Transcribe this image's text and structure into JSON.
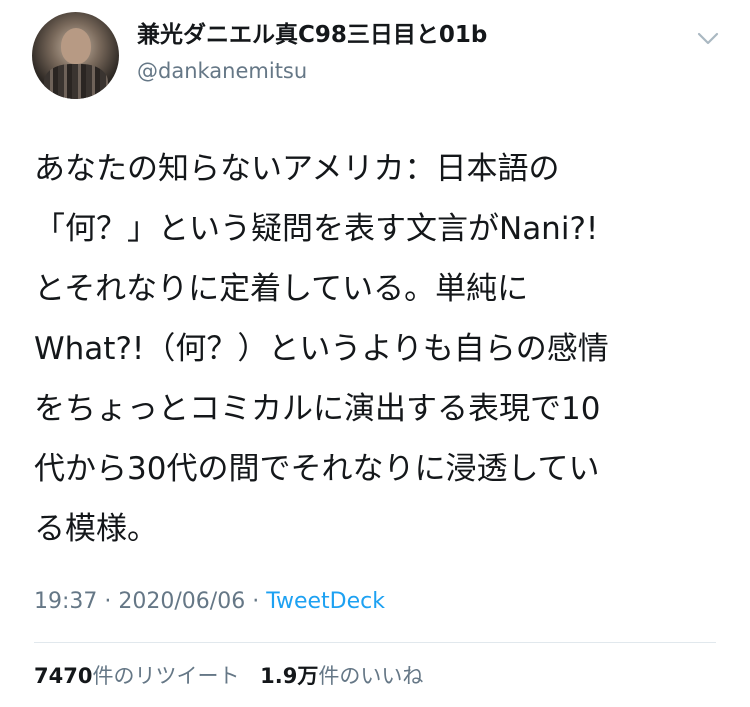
{
  "author": {
    "display_name": "兼光ダニエル真C98三日目と01b",
    "handle": "@dankanemitsu"
  },
  "tweet": {
    "lines": [
      "あなたの知らないアメリカ：日本語の",
      "「何？」という疑問を表す文言がNani?!",
      "とそれなりに定着している。単純に",
      "What?!（何？）というよりも自らの感情",
      "をちょっとコミカルに演出する表現で10",
      "代から30代の間でそれなりに浸透してい",
      "る模様。"
    ]
  },
  "meta": {
    "time": "19:37",
    "separator1": " · ",
    "date": "2020/06/06",
    "separator2": " · ",
    "source": "TweetDeck"
  },
  "stats": {
    "retweets_count": "7470",
    "retweets_label": "件のリツイート",
    "likes_count": "1.9万",
    "likes_label": "件のいいね"
  },
  "icons": {
    "menu": "chevron-down-icon",
    "avatar": "avatar"
  },
  "colors": {
    "text": "#14171a",
    "secondary": "#657786",
    "link": "#1da1f2",
    "divider": "#e1e8ed"
  }
}
